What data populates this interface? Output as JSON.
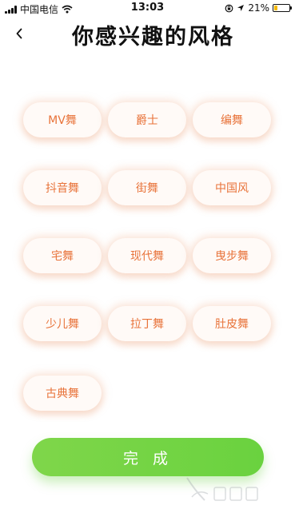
{
  "status_bar": {
    "carrier": "中国电信",
    "time": "13:03",
    "battery_percent": "21%",
    "battery_level": 0.21,
    "icons": [
      "signal-bars-icon",
      "wifi-icon",
      "orientation-lock-icon",
      "location-arrow-icon",
      "battery-icon"
    ]
  },
  "header": {
    "back_icon": "chevron-left-icon",
    "title": "你感兴趣的风格"
  },
  "tags": [
    "MV舞",
    "爵士",
    "编舞",
    "抖音舞",
    "街舞",
    "中国风",
    "宅舞",
    "现代舞",
    "曳步舞",
    "少儿舞",
    "拉丁舞",
    "肚皮舞",
    "古典舞"
  ],
  "done_button": {
    "label": "完 成"
  },
  "colors": {
    "tag_text": "#e8733a",
    "tag_bg": "#fffaf7",
    "done_button": "#6ad23f",
    "title": "#111111"
  }
}
